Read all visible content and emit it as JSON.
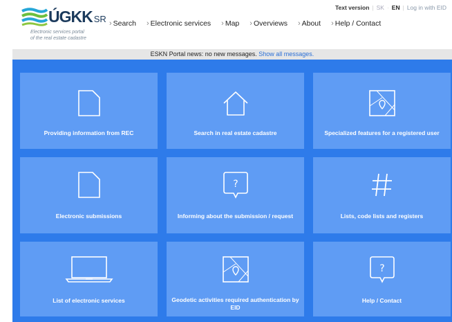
{
  "header": {
    "logo_text": "ÚGKK",
    "logo_suffix": "SR",
    "logo_tagline_1": "Electronic services portal",
    "logo_tagline_2": "of the real estate cadastre",
    "text_version": "Text version",
    "lang_sk": "SK",
    "lang_en": "EN",
    "login": "Log in with EID"
  },
  "nav": {
    "items": [
      {
        "label": "Search"
      },
      {
        "label": "Electronic services"
      },
      {
        "label": "Map"
      },
      {
        "label": "Overviews"
      },
      {
        "label": "About"
      },
      {
        "label": "Help / Contact"
      }
    ]
  },
  "news": {
    "text": "ESKN Portal news: no new messages.",
    "link": "Show all messages."
  },
  "tiles": [
    {
      "label": "Providing information from REC",
      "icon": "document-icon"
    },
    {
      "label": "Search in real estate cadastre",
      "icon": "house-icon"
    },
    {
      "label": "Specialized features for a registered user",
      "icon": "map-pin-icon"
    },
    {
      "label": "Electronic submissions",
      "icon": "document-icon"
    },
    {
      "label": "Informing about the submission / request",
      "icon": "question-bubble-icon"
    },
    {
      "label": "Lists, code lists and registers",
      "icon": "hash-icon"
    },
    {
      "label": "List of electronic services",
      "icon": "laptop-icon"
    },
    {
      "label": "Geodetic activities required authentication by EID",
      "icon": "map-pin-icon"
    },
    {
      "label": "Help / Contact",
      "icon": "question-bubble-icon"
    }
  ],
  "colors": {
    "main_bg": "#2e7bea",
    "tile_bg": "#5f9cf4",
    "link": "#2b6fd6"
  }
}
